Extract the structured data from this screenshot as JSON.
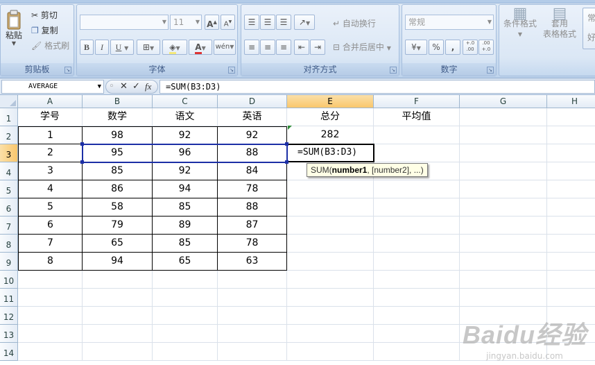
{
  "ribbon": {
    "clipboard": {
      "title": "剪贴板",
      "paste": "粘贴",
      "cut": "剪切",
      "copy": "复制",
      "format_painter": "格式刷"
    },
    "font": {
      "title": "字体",
      "font_name": "",
      "font_size": "11",
      "bold": "B",
      "italic": "I",
      "underline": "U",
      "grow": "A",
      "shrink": "A",
      "font_color": "A",
      "phonetic": "wén"
    },
    "alignment": {
      "title": "对齐方式",
      "wrap_text": "自动换行",
      "merge_center": "合并后居中"
    },
    "number": {
      "title": "数字",
      "format": "常规",
      "percent": "%",
      "comma": ",",
      "inc_decimal": "+.0 .00",
      "dec_decimal": ".00 +.0"
    },
    "styles": {
      "conditional": "条件格式",
      "table_format_1": "套用",
      "table_format_2": "表格格式",
      "cell_style_1": "常",
      "cell_style_2": "好"
    }
  },
  "formula_bar": {
    "name_box": "AVERAGE",
    "cancel": "✕",
    "enter": "✓",
    "fx": "fx",
    "formula": "=SUM(B3:D3)"
  },
  "sheet": {
    "columns": [
      "A",
      "B",
      "C",
      "D",
      "E",
      "F",
      "G",
      "H"
    ],
    "rows": [
      "1",
      "2",
      "3",
      "4",
      "5",
      "6",
      "7",
      "8",
      "9",
      "10",
      "11",
      "12",
      "13",
      "14"
    ],
    "headers": [
      "学号",
      "数学",
      "语文",
      "英语",
      "总分",
      "平均值"
    ],
    "data": [
      [
        "1",
        "98",
        "92",
        "92",
        "282",
        ""
      ],
      [
        "2",
        "95",
        "96",
        "88",
        "=SUM(B3:D3)",
        ""
      ],
      [
        "3",
        "85",
        "92",
        "84",
        "",
        ""
      ],
      [
        "4",
        "86",
        "94",
        "78",
        "",
        ""
      ],
      [
        "5",
        "58",
        "85",
        "88",
        "",
        ""
      ],
      [
        "6",
        "79",
        "89",
        "87",
        "",
        ""
      ],
      [
        "7",
        "65",
        "85",
        "78",
        "",
        ""
      ],
      [
        "8",
        "94",
        "65",
        "63",
        "",
        ""
      ]
    ],
    "active_cell": "E3",
    "tooltip_prefix": "SUM(",
    "tooltip_bold": "number1",
    "tooltip_rest": ", [number2], ...)"
  },
  "watermark": {
    "line1": "Baidu经验",
    "line2": "jingyan.baidu.com"
  },
  "colors": {
    "selection": "#1c2fa6",
    "header_active": "#f9c76d",
    "ribbon_bg": "#c9dbef"
  }
}
